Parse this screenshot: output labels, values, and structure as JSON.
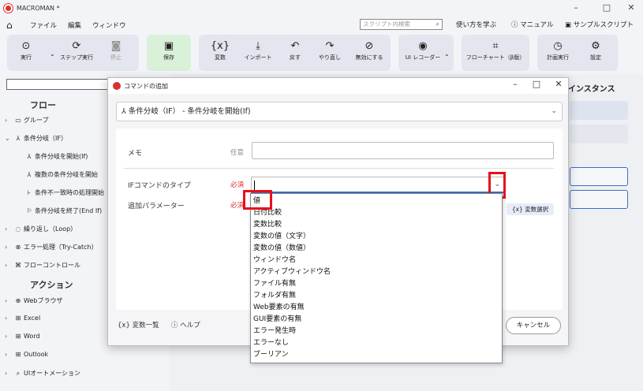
{
  "window": {
    "title": "MACROMAN *",
    "min": "–",
    "max": "□",
    "close": "✕"
  },
  "menubar": {
    "items": [
      "ファイル",
      "編集",
      "ウィンドウ"
    ],
    "search_placeholder": "スクリプト内検索",
    "links": [
      "使い方を学ぶ",
      "マニュアル",
      "サンプルスクリプト"
    ]
  },
  "toolbar": {
    "run": "実行",
    "step_run": "ステップ実行",
    "stop": "停止",
    "save": "保存",
    "variables": "変数",
    "import": "インポート",
    "undo": "戻す",
    "redo": "やり直し",
    "disable": "無効にする",
    "ui_recorder": "UI レコーダー",
    "flowchart": "フローチャート（β版）",
    "schedule": "計画実行",
    "settings": "設定"
  },
  "sidebar": {
    "flow_header": "フロー",
    "flow_items": [
      {
        "label": "グループ",
        "level": 0
      },
      {
        "label": "条件分岐（IF）",
        "level": 0
      },
      {
        "label": "条件分岐を開始(If)",
        "level": 1
      },
      {
        "label": "複数の条件分岐を開始",
        "level": 1
      },
      {
        "label": "条件不一致時の処理開始",
        "level": 1
      },
      {
        "label": "条件分岐を終了(End If)",
        "level": 1
      },
      {
        "label": "繰り返し（Loop）",
        "level": 0
      },
      {
        "label": "エラー処理（Try-Catch）",
        "level": 0
      },
      {
        "label": "フローコントロール",
        "level": 0
      }
    ],
    "action_header": "アクション",
    "action_items": [
      "Webブラウザ",
      "Excel",
      "Word",
      "Outlook",
      "UIオートメーション"
    ]
  },
  "right_panel": {
    "title": "インスタンス"
  },
  "dialog": {
    "title": "コマンドの追加",
    "command": "条件分岐（IF） - 条件分岐を開始(If)",
    "memo_label": "メモ",
    "optional": "任意",
    "if_type_label": "IFコマンドのタイプ",
    "param_label": "追加パラメーター",
    "required": "必須",
    "var_select": "変数選択",
    "var_list": "変数一覧",
    "help": "ヘルプ",
    "cancel": "キャンセル",
    "if_type_value": "",
    "options": [
      "値",
      "日付比較",
      "変数比較",
      "変数の値（文字）",
      "変数の値（数値）",
      "ウィンドウ名",
      "アクティブウィンドウ名",
      "ファイル有無",
      "フォルダ有無",
      "Web要素の有無",
      "GUI要素の有無",
      "エラー発生時",
      "エラーなし",
      "ブーリアン"
    ]
  },
  "colors": {
    "highlight_red": "#e8101a",
    "accent_blue": "#3a6fc8",
    "save_green": "#d9f0d9"
  }
}
